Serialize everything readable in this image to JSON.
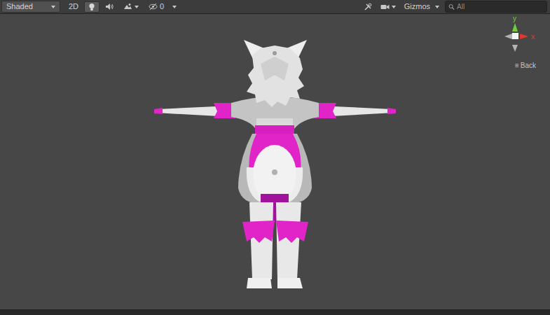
{
  "toolbar": {
    "shading_mode": "Shaded",
    "mode_2d": {
      "label": "2D",
      "selected": false
    },
    "lighting": {
      "selected": true
    },
    "audio": {
      "selected": false
    },
    "effects": {
      "selected": false
    },
    "hidden_count": "0",
    "gizmos": "Gizmos",
    "search": {
      "placeholder": "All"
    }
  },
  "orientation_gizmo": {
    "axes": [
      {
        "label": "y",
        "color": "#6fd03c"
      },
      {
        "label": "x",
        "color": "#e0382c"
      }
    ],
    "view_icon": "≡",
    "view": "Back"
  }
}
